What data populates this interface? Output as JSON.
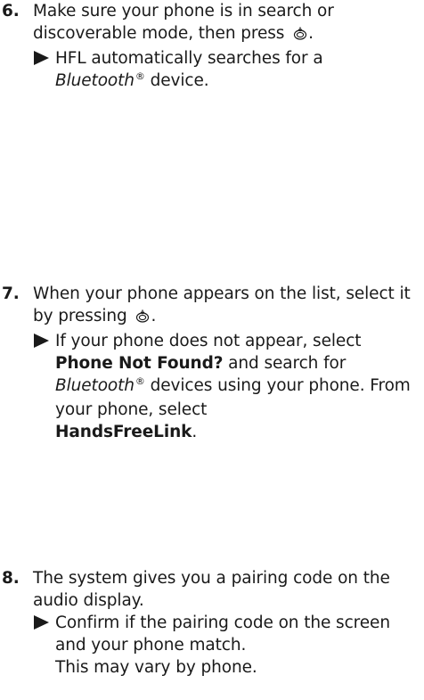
{
  "steps": [
    {
      "number": "6.",
      "text_before_icon": "Make sure your phone is in search or discoverable mode, then press",
      "text_after_icon": ".",
      "icon": "selector-knob-icon",
      "result_prefix": "HFL automatically searches for a",
      "result_bt": "Bluetooth",
      "result_reg": "®",
      "result_suffix": " device."
    },
    {
      "number": "7.",
      "text_before_icon": "When your phone appears on the list, select it by pressing",
      "text_after_icon": ".",
      "icon": "selector-knob-icon",
      "result_prefix": "If your phone does not appear, select",
      "result_bold_1": "Phone Not Found?",
      "result_mid_1": " and search for",
      "result_bt": "Bluetooth",
      "result_reg": "®",
      "result_mid_2": " devices using your phone. From your phone, select",
      "result_bold_2": "HandsFreeLink",
      "result_end": "."
    },
    {
      "number": "8.",
      "text": "The system gives you a pairing code on the audio display.",
      "result_1": "Confirm if the pairing code on the screen and your phone match.",
      "result_2": "This may vary by phone."
    }
  ],
  "colors": {
    "text": "#1a1a1a",
    "background": "#ffffff"
  }
}
